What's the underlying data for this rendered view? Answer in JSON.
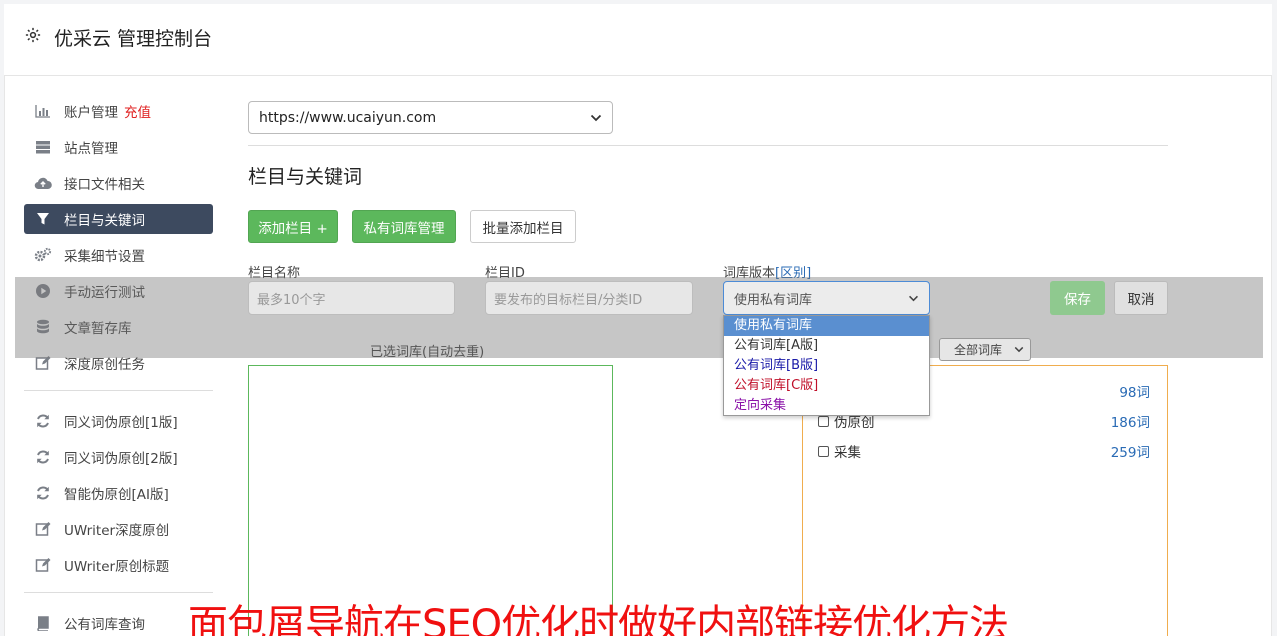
{
  "header": {
    "title": "优采云 管理控制台",
    "icon": "gear-icon"
  },
  "sidebar": {
    "items": [
      {
        "label": "账户管理",
        "badge": "充值",
        "icon": "bar-chart-icon"
      },
      {
        "label": "站点管理",
        "icon": "server-icon"
      },
      {
        "label": "接口文件相关",
        "icon": "cloud-upload-icon"
      },
      {
        "label": "栏目与关键词",
        "icon": "filter-icon",
        "active": true
      },
      {
        "label": "采集细节设置",
        "icon": "cogs-icon"
      },
      {
        "label": "手动运行测试",
        "icon": "play-circle-icon"
      },
      {
        "label": "文章暂存库",
        "icon": "database-icon"
      },
      {
        "label": "深度原创任务",
        "icon": "edit-icon"
      }
    ],
    "items2": [
      {
        "label": "同义词伪原创[1版]",
        "icon": "refresh-icon"
      },
      {
        "label": "同义词伪原创[2版]",
        "icon": "refresh-icon"
      },
      {
        "label": "智能伪原创[AI版]",
        "icon": "refresh-icon"
      },
      {
        "label": "UWriter深度原创",
        "icon": "edit-icon"
      },
      {
        "label": "UWriter原创标题",
        "icon": "edit-icon"
      }
    ],
    "items3": [
      {
        "label": "公有词库查询",
        "icon": "book-icon"
      }
    ]
  },
  "site_select": {
    "value": "https://www.ucaiyun.com"
  },
  "section": {
    "title": "栏目与关键词"
  },
  "buttons": {
    "add_column": "添加栏目 +",
    "private_lib": "私有词库管理",
    "batch_add": "批量添加栏目"
  },
  "form": {
    "name_label": "栏目名称",
    "name_placeholder": "最多10个字",
    "id_label": "栏目ID",
    "id_placeholder": "要发布的目标栏目/分类ID",
    "version_label": "词库版本",
    "version_link": "[区别]",
    "version_value": "使用私有词库",
    "save": "保存",
    "cancel": "取消"
  },
  "dropdown": {
    "options": [
      {
        "label": "使用私有词库",
        "color": "#ffffff",
        "selected": true
      },
      {
        "label": "公有词库[A版]",
        "color": "#333333"
      },
      {
        "label": "公有词库[B版]",
        "color": "#1a1aa8"
      },
      {
        "label": "公有词库[C版]",
        "color": "#c0102a"
      },
      {
        "label": "定向采集",
        "color": "#8a10a8"
      }
    ]
  },
  "selected_libs": {
    "label": "已选词库(自动去重)"
  },
  "lib_filter": {
    "value": "全部词库"
  },
  "libs": [
    {
      "name": "",
      "count": "98词"
    },
    {
      "name": "伪原创",
      "count": "186词"
    },
    {
      "name": "采集",
      "count": "259词"
    }
  ],
  "banner": {
    "text": "面包屑导航在SEO优化时做好内部链接优化方法"
  }
}
